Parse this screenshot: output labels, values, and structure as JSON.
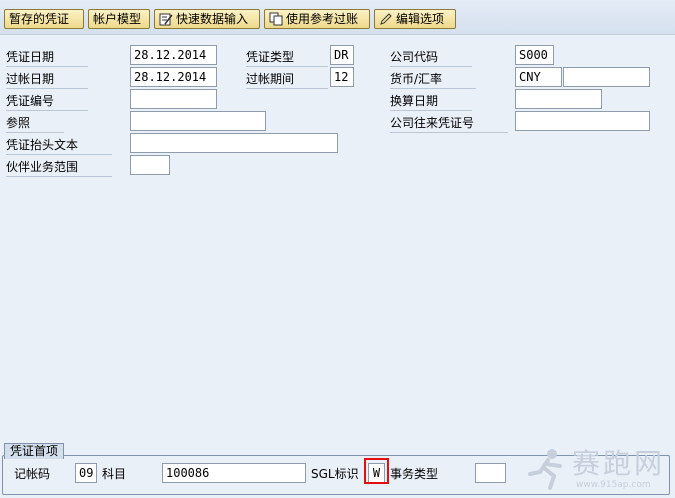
{
  "toolbar": {
    "items": [
      {
        "label": "暂存的凭证",
        "icon": null
      },
      {
        "label": "帐户模型",
        "icon": null
      },
      {
        "label": "快速数据输入",
        "icon": "form-edit-icon"
      },
      {
        "label": "使用参考过账",
        "icon": "copy-document-icon"
      },
      {
        "label": "编辑选项",
        "icon": "pencil-icon"
      }
    ]
  },
  "header": {
    "doc_date_label": "凭证日期",
    "doc_date": "28.12.2014",
    "post_date_label": "过帐日期",
    "post_date": "28.12.2014",
    "doc_number_label": "凭证编号",
    "doc_number": "",
    "reference_label": "参照",
    "reference": "",
    "header_text_label": "凭证抬头文本",
    "header_text": "",
    "partner_ba_label": "伙伴业务范围",
    "partner_ba": "",
    "doc_type_label": "凭证类型",
    "doc_type": "DR",
    "period_label": "过帐期间",
    "period": "12",
    "company_code_label": "公司代码",
    "company_code": "S000",
    "currency_label": "货币/汇率",
    "currency": "CNY",
    "exchange_rate": "",
    "translation_date_label": "换算日期",
    "translation_date": "",
    "cross_cc_label": "公司往来凭证号",
    "cross_cc": ""
  },
  "first_line": {
    "group_title": "凭证首项",
    "posting_key_label": "记帐码",
    "posting_key": "09",
    "account_label": "科目",
    "account": "100086",
    "sgl_label": "SGL标识",
    "sgl": "W",
    "trans_type_label": "事务类型",
    "trans_type": ""
  },
  "watermark": {
    "text": "赛跑网",
    "url": "www.915ap.com"
  }
}
